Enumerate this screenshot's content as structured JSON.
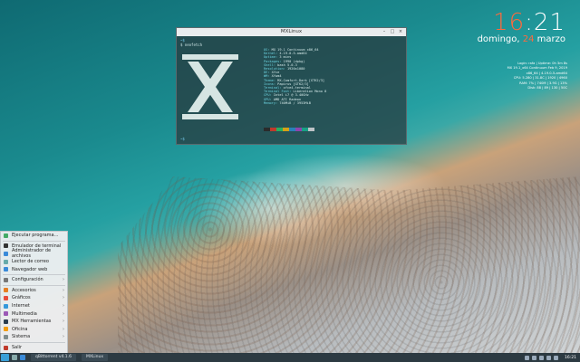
{
  "terminal": {
    "title": "MXLinux",
    "prompt_user": "~$",
    "command": "$ neofetch",
    "info": [
      {
        "k": "OS:",
        "v": "MX 19.1 Continuum x86_64"
      },
      {
        "k": "Kernel:",
        "v": "4.19.0-5-amd64"
      },
      {
        "k": "Uptime:",
        "v": "3 mins"
      },
      {
        "k": "Packages:",
        "v": "1990 (dpkg)"
      },
      {
        "k": "Shell:",
        "v": "bash 5.0.3"
      },
      {
        "k": "Resolution:",
        "v": "1920x1080"
      },
      {
        "k": "DE:",
        "v": "Xfce"
      },
      {
        "k": "WM:",
        "v": "Xfwm4"
      },
      {
        "k": "Theme:",
        "v": "MX-Comfort-Dark [GTK2/3]"
      },
      {
        "k": "Icons:",
        "v": "Papirus [GTK2/3]"
      },
      {
        "k": "Terminal:",
        "v": "xfce4-terminal"
      },
      {
        "k": "Terminal Font:",
        "v": "Liberation Mono 8"
      },
      {
        "k": "CPU:",
        "v": "Intel i7 @ 3.40GHz"
      },
      {
        "k": "GPU:",
        "v": "AMD ATI Radeon"
      },
      {
        "k": "Memory:",
        "v": "740MiB / 3953MiB"
      }
    ],
    "swatch_colors": [
      "#2b2b2b",
      "#c0392b",
      "#27ae60",
      "#d4a017",
      "#2980b9",
      "#8e44ad",
      "#16a085",
      "#bdc3c7"
    ]
  },
  "clock": {
    "hour": "16",
    "minute": ":21",
    "day": "domingo, ",
    "date_num": "24",
    "month": " marzo"
  },
  "sysinfo": [
    "Login: rafa | Uptime: 0h 3m 8s",
    "MX 19.1_x64 Continuum Feb 9, 2019",
    "x86_64 | 4.19.0-5-amd64",
    "CPU: 5.280 | 31.8C | 1920 | 4960",
    "RAM: 7% | 740M | 3.9G | 13%",
    "Disk: 88 | 89 | 130 | 50C"
  ],
  "menu": {
    "items": [
      {
        "label": "Ejecutar programa...",
        "color": "#4a6",
        "arrow": false
      },
      {
        "sep": true
      },
      {
        "label": "Emulador de terminal",
        "color": "#333",
        "arrow": false
      },
      {
        "label": "Administrador de archivos",
        "color": "#3a8ad8",
        "arrow": false
      },
      {
        "label": "Lector de correo",
        "color": "#6aa",
        "arrow": false
      },
      {
        "label": "Navegador web",
        "color": "#3a8ad8",
        "arrow": false
      },
      {
        "sep": true
      },
      {
        "label": "Configuración",
        "color": "#777",
        "arrow": true
      },
      {
        "sep": true
      },
      {
        "label": "Accesorios",
        "color": "#e67e22",
        "arrow": true
      },
      {
        "label": "Gráficos",
        "color": "#e74c3c",
        "arrow": true
      },
      {
        "label": "Internet",
        "color": "#3498db",
        "arrow": true
      },
      {
        "label": "Multimedia",
        "color": "#9b59b6",
        "arrow": true
      },
      {
        "label": "MX Herramientas",
        "color": "#2c3e50",
        "arrow": true
      },
      {
        "label": "Oficina",
        "color": "#f39c12",
        "arrow": true
      },
      {
        "label": "Sistema",
        "color": "#7f8c8d",
        "arrow": true
      },
      {
        "sep": true
      },
      {
        "label": "Salir",
        "color": "#c0392b",
        "arrow": false
      }
    ]
  },
  "taskbar": {
    "task1": "qBittorrent v4.1.6",
    "task2": "MXLinux",
    "clock": "16:21"
  }
}
